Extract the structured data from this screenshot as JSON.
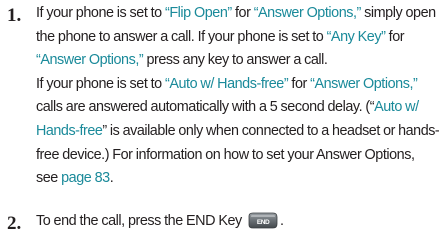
{
  "steps": [
    {
      "number": "1.",
      "lines": [
        [
          {
            "t": "If your phone is set to "
          },
          {
            "t": "“Flip Open”",
            "hl": true
          },
          {
            "t": " for "
          },
          {
            "t": "“Answer Options,”",
            "hl": true
          },
          {
            "t": " simply open"
          }
        ],
        [
          {
            "t": "the phone to answer a call. If your phone is set to "
          },
          {
            "t": "“Any Key”",
            "hl": true
          },
          {
            "t": " for"
          }
        ],
        [
          {
            "t": "“Answer Options,”",
            "hl": true
          },
          {
            "t": " press any key to answer a call."
          }
        ],
        [
          {
            "t": "If your phone is set to "
          },
          {
            "t": "“Auto w/ Hands-free”",
            "hl": true
          },
          {
            "t": " for "
          },
          {
            "t": "“Answer Options,”",
            "hl": true
          }
        ],
        [
          {
            "t": "calls are answered automatically with a 5 second delay. (“"
          },
          {
            "t": "Auto w/",
            "hl": true
          }
        ],
        [
          {
            "t": "Hands-free",
            "hl": true
          },
          {
            "t": "” is available only when connected to a headset or hands-"
          }
        ],
        [
          {
            "t": "free device.) For information on how to set your Answer Options,"
          }
        ],
        [
          {
            "t": "see "
          },
          {
            "t": "page 83",
            "hl": true,
            "link": true
          },
          {
            "t": "."
          }
        ]
      ]
    },
    {
      "number": "2.",
      "lines": [
        [
          {
            "t": "To end the call, press the END Key "
          },
          {
            "icon": "end-key-icon"
          },
          {
            "t": "."
          }
        ]
      ]
    }
  ],
  "icons": {
    "end_key_label": "END"
  },
  "colors": {
    "text": "#231f20",
    "highlight": "#1a8a9a"
  }
}
